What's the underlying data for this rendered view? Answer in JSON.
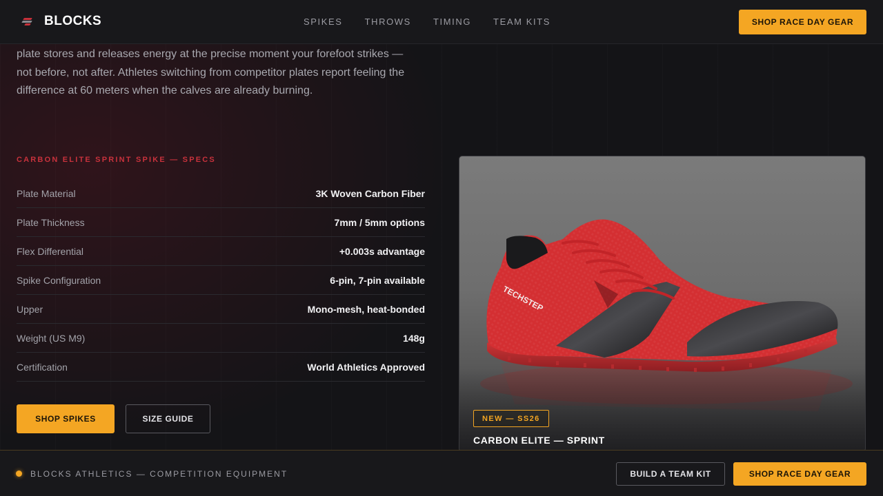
{
  "header": {
    "brand": "BLOCKS",
    "logo_icon": "speed-slash-icon",
    "nav": [
      "SPIKES",
      "THROWS",
      "TIMING",
      "TEAM KITS"
    ],
    "cta_label": "SHOP RACE DAY GEAR"
  },
  "intro": {
    "text": "plate stores and releases energy at the precise moment your forefoot strikes — not before, not after. Athletes switching from competitor plates report feeling the difference at 60 meters when the calves are already burning."
  },
  "specs": {
    "title": "CARBON ELITE SPRINT SPIKE — SPECS",
    "rows": [
      {
        "label": "Plate Material",
        "value": "3K Woven Carbon Fiber"
      },
      {
        "label": "Plate Thickness",
        "value": "7mm / 5mm options"
      },
      {
        "label": "Flex Differential",
        "value": "+0.003s advantage"
      },
      {
        "label": "Spike Configuration",
        "value": "6-pin, 7-pin available"
      },
      {
        "label": "Upper",
        "value": "Mono-mesh, heat-bonded"
      },
      {
        "label": "Weight (US M9)",
        "value": "148g"
      },
      {
        "label": "Certification",
        "value": "World Athletics Approved"
      }
    ],
    "primary_cta": "SHOP SPIKES",
    "secondary_cta": "SIZE GUIDE"
  },
  "product_card": {
    "badge": "NEW — SS26",
    "title": "CARBON ELITE — SPRINT",
    "shoe_brand_text": "TECHSTEP"
  },
  "footer": {
    "label": "BLOCKS ATHLETICS — COMPETITION EQUIPMENT",
    "secondary_cta": "BUILD A TEAM KIT",
    "primary_cta": "SHOP RACE DAY GEAR"
  },
  "colors": {
    "accent": "#f4a623",
    "brand_red": "#c8323c",
    "background": "#141417"
  }
}
